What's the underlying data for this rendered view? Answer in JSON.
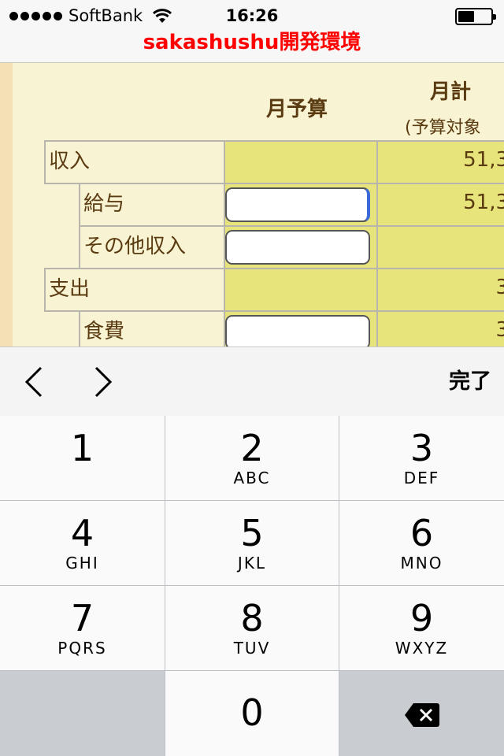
{
  "status": {
    "carrier": "SoftBank",
    "time": "16:26",
    "signal_icon": "signal-dots-icon",
    "wifi_icon": "wifi-icon",
    "battery_icon": "battery-icon"
  },
  "page": {
    "title": "sakashushu開発環境"
  },
  "table": {
    "col_budget": "月予算",
    "col_total": "月計",
    "col_total_sub": "(予算対象",
    "rows": [
      {
        "label": "収入",
        "total": "51,3"
      },
      {
        "label": "給与",
        "total": "51,3"
      },
      {
        "label": "その他収入",
        "total": ""
      },
      {
        "label": "支出",
        "total": "3"
      },
      {
        "label": "食費",
        "total": "3"
      }
    ]
  },
  "accessory": {
    "prev_icon": "chevron-left-icon",
    "next_icon": "chevron-right-icon",
    "done_label": "完了"
  },
  "keypad": {
    "keys": [
      {
        "num": "1",
        "letters": ""
      },
      {
        "num": "2",
        "letters": "ABC"
      },
      {
        "num": "3",
        "letters": "DEF"
      },
      {
        "num": "4",
        "letters": "GHI"
      },
      {
        "num": "5",
        "letters": "JKL"
      },
      {
        "num": "6",
        "letters": "MNO"
      },
      {
        "num": "7",
        "letters": "PQRS"
      },
      {
        "num": "8",
        "letters": "TUV"
      },
      {
        "num": "9",
        "letters": "WXYZ"
      },
      {
        "num": "0",
        "letters": ""
      }
    ],
    "delete_icon": "backspace-icon"
  }
}
